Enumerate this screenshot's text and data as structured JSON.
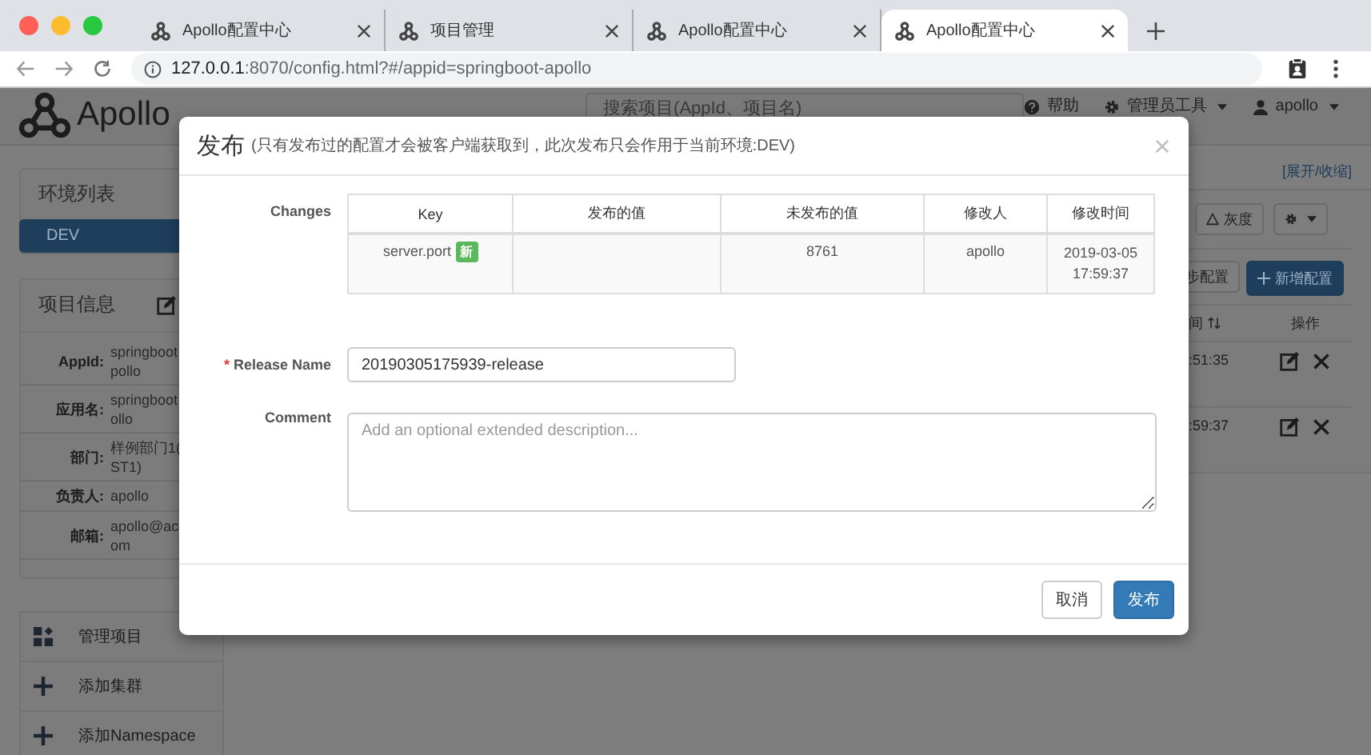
{
  "browser": {
    "tabs": [
      {
        "title": "Apollo配置中心",
        "selected": false
      },
      {
        "title": "项目管理",
        "selected": false
      },
      {
        "title": "Apollo配置中心",
        "selected": false
      },
      {
        "title": "Apollo配置中心",
        "selected": true
      }
    ],
    "address": {
      "host": "127.0.0.1",
      "rest": ":8070/config.html?#/appid=springboot-apollo"
    }
  },
  "header": {
    "logo": "Apollo",
    "search": {
      "placeholder": "搜索项目(AppId、项目名)"
    },
    "nav": [
      {
        "kind": "help",
        "label": "帮助"
      },
      {
        "kind": "admin",
        "label": "管理员工具"
      },
      {
        "kind": "user",
        "label": "apollo"
      }
    ]
  },
  "sidebar": {
    "env_panel": {
      "title": "环境列表",
      "items": [
        {
          "label": "DEV",
          "selected": true
        }
      ]
    },
    "info_panel": {
      "title": "项目信息",
      "fields": [
        {
          "label": "AppId:",
          "lines": [
            "springboot",
            "pollo"
          ]
        },
        {
          "label": "应用名:",
          "lines": [
            "springboot",
            "ollo"
          ]
        },
        {
          "label": "部门:",
          "lines": [
            "样例部门1(",
            "ST1)"
          ]
        },
        {
          "label": "负责人:",
          "lines": [
            "apollo"
          ]
        },
        {
          "label": "邮箱:",
          "lines": [
            "apollo@ac",
            "om"
          ]
        }
      ]
    },
    "actions": [
      {
        "kind": "manage",
        "label": "管理项目"
      },
      {
        "kind": "add",
        "label": "添加集群"
      },
      {
        "kind": "add",
        "label": "添加Namespace"
      }
    ]
  },
  "config_panel": {
    "toggle_link": "[展开/收缩]",
    "gray_button": "灰度",
    "sync_button": "步配置",
    "add_button": "新增配置",
    "columns": [
      "间",
      "操作"
    ],
    "rows": [
      {
        "time": ":51:35"
      },
      {
        "time": ":59:37"
      }
    ]
  },
  "modal": {
    "title": "发布",
    "subtitle": "(只有发布过的配置才会被客户端获取到，此次发布只会作用于当前环境:DEV)",
    "changes": {
      "label": "Changes",
      "columns": [
        "Key",
        "发布的值",
        "未发布的值",
        "修改人",
        "修改时间"
      ],
      "rows": [
        {
          "key": "server.port",
          "badge": "新",
          "new_value": "8761",
          "modifier": "apollo",
          "time": "2019-03-05 17:59:37"
        }
      ]
    },
    "release_name": {
      "label": "Release Name",
      "required_mark": "*",
      "value": "20190305175939-release"
    },
    "comment": {
      "label": "Comment",
      "placeholder": "Add an optional extended description..."
    },
    "buttons": [
      {
        "kind": "default",
        "label": "取消"
      },
      {
        "kind": "primary",
        "label": "发布"
      }
    ]
  }
}
